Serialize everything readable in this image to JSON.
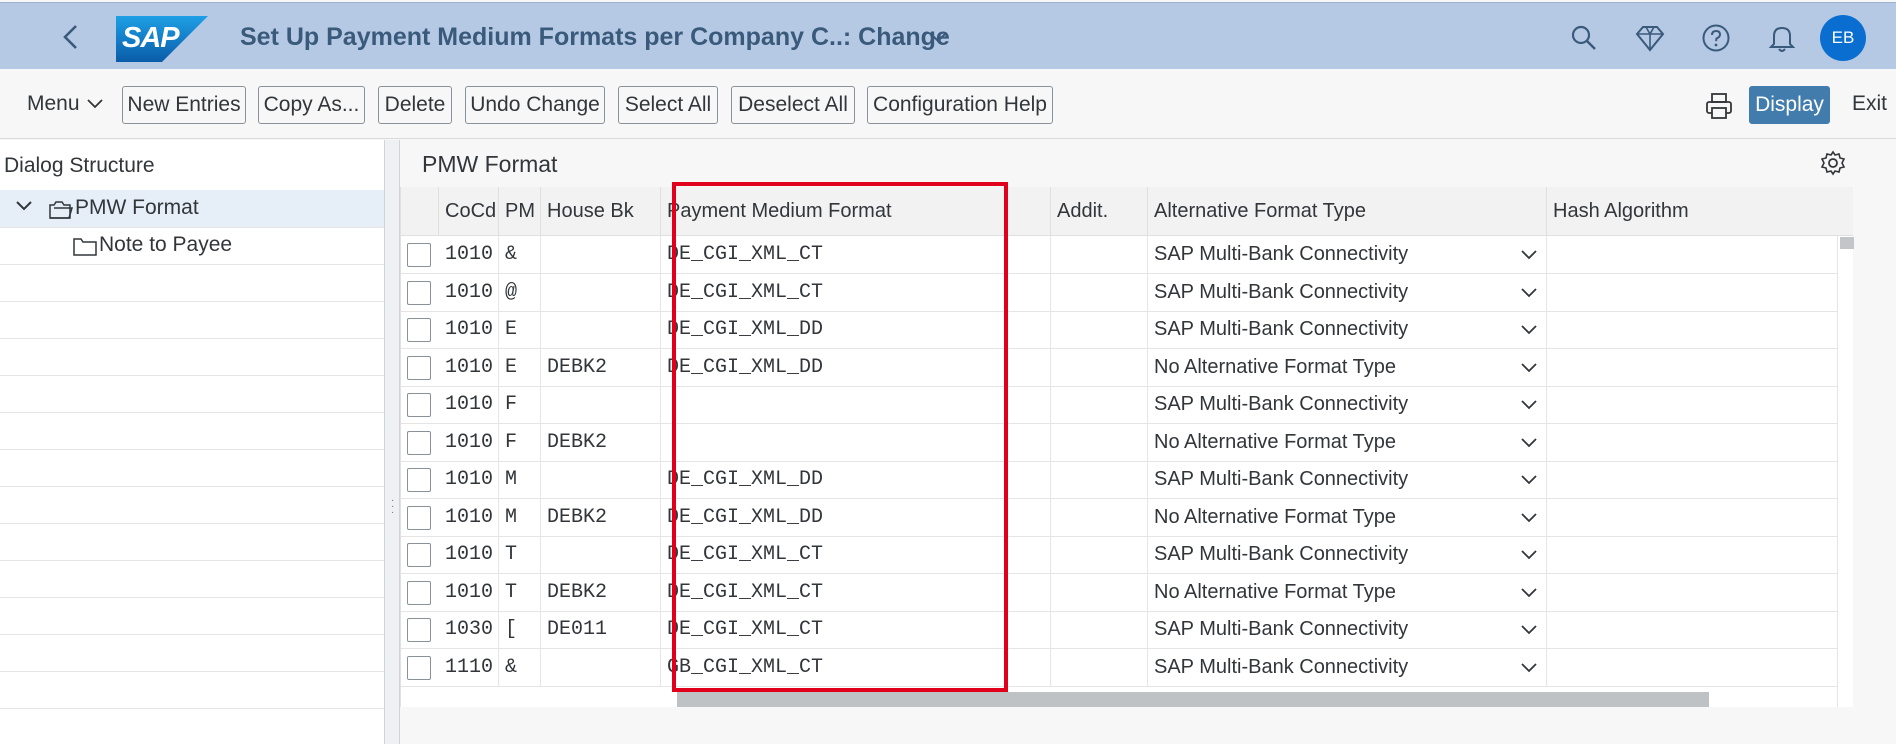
{
  "shell": {
    "title": "Set Up Payment Medium Formats per Company C..: Change",
    "logo_text": "SAP",
    "avatar_initials": "EB",
    "icons": [
      "back-icon",
      "search-icon",
      "diamond-icon",
      "help-icon",
      "bell-icon"
    ]
  },
  "toolbar": {
    "menu_label": "Menu",
    "new_entries": "New Entries",
    "copy_as": "Copy As...",
    "delete": "Delete",
    "undo_change": "Undo Change",
    "select_all": "Select All",
    "deselect_all": "Deselect All",
    "configuration_help": "Configuration Help",
    "display": "Display",
    "exit": "Exit"
  },
  "dialog_structure": {
    "title": "Dialog Structure",
    "items": [
      {
        "label": "PMW Format",
        "selected": true,
        "expanded": true
      },
      {
        "label": "Note to Payee",
        "selected": false
      }
    ]
  },
  "table": {
    "title": "PMW Format",
    "columns": [
      "CoCd",
      "PM",
      "House Bk",
      "Payment Medium Format",
      "Addit.",
      "Alternative Format Type",
      "Hash Algorithm"
    ],
    "rows": [
      {
        "cocd": "1010",
        "pm": "&",
        "house_bk": "",
        "pmf": "DE_CGI_XML_CT",
        "addit": "",
        "aft": "SAP Multi-Bank Connectivity",
        "hash": ""
      },
      {
        "cocd": "1010",
        "pm": "@",
        "house_bk": "",
        "pmf": "DE_CGI_XML_CT",
        "addit": "",
        "aft": "SAP Multi-Bank Connectivity",
        "hash": ""
      },
      {
        "cocd": "1010",
        "pm": "E",
        "house_bk": "",
        "pmf": "DE_CGI_XML_DD",
        "addit": "",
        "aft": "SAP Multi-Bank Connectivity",
        "hash": ""
      },
      {
        "cocd": "1010",
        "pm": "E",
        "house_bk": "DEBK2",
        "pmf": "DE_CGI_XML_DD",
        "addit": "",
        "aft": "No Alternative Format Type",
        "hash": ""
      },
      {
        "cocd": "1010",
        "pm": "F",
        "house_bk": "",
        "pmf": "",
        "addit": "",
        "aft": "SAP Multi-Bank Connectivity",
        "hash": ""
      },
      {
        "cocd": "1010",
        "pm": "F",
        "house_bk": "DEBK2",
        "pmf": "",
        "addit": "",
        "aft": "No Alternative Format Type",
        "hash": ""
      },
      {
        "cocd": "1010",
        "pm": "M",
        "house_bk": "",
        "pmf": "DE_CGI_XML_DD",
        "addit": "",
        "aft": "SAP Multi-Bank Connectivity",
        "hash": ""
      },
      {
        "cocd": "1010",
        "pm": "M",
        "house_bk": "DEBK2",
        "pmf": "DE_CGI_XML_DD",
        "addit": "",
        "aft": "No Alternative Format Type",
        "hash": ""
      },
      {
        "cocd": "1010",
        "pm": "T",
        "house_bk": "",
        "pmf": "DE_CGI_XML_CT",
        "addit": "",
        "aft": "SAP Multi-Bank Connectivity",
        "hash": ""
      },
      {
        "cocd": "1010",
        "pm": "T",
        "house_bk": "DEBK2",
        "pmf": "DE_CGI_XML_CT",
        "addit": "",
        "aft": "No Alternative Format Type",
        "hash": ""
      },
      {
        "cocd": "1030",
        "pm": "[",
        "house_bk": "DE011",
        "pmf": "DE_CGI_XML_CT",
        "addit": "",
        "aft": "SAP Multi-Bank Connectivity",
        "hash": ""
      },
      {
        "cocd": "1110",
        "pm": "&",
        "house_bk": "",
        "pmf": "GB_CGI_XML_CT",
        "addit": "",
        "aft": "SAP Multi-Bank Connectivity",
        "hash": ""
      }
    ]
  },
  "colors": {
    "shell_bg": "#b6c9e4",
    "accent": "#0a6ed1",
    "emphasized_button": "#427cac",
    "highlight_box": "#e0001b"
  }
}
